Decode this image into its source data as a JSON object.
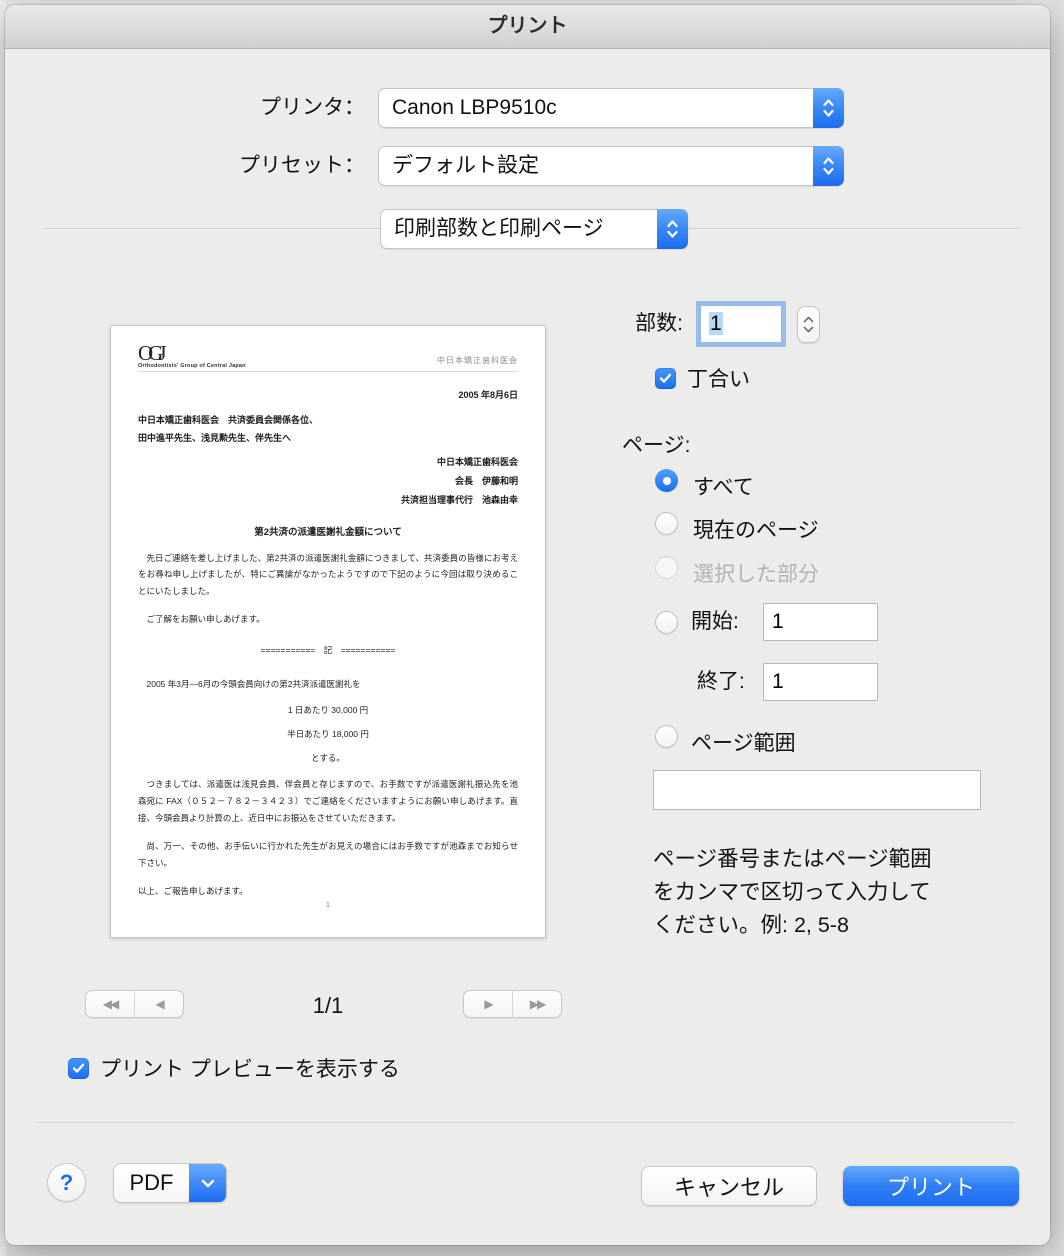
{
  "window": {
    "title": "プリント"
  },
  "form": {
    "printer_label": "プリンタ：",
    "printer_value": "Canon LBP9510c",
    "preset_label": "プリセット：",
    "preset_value": "デフォルト設定",
    "section_value": "印刷部数と印刷ページ"
  },
  "copies": {
    "label": "部数:",
    "value": "1",
    "collate_label": "丁合い",
    "collate_checked": true
  },
  "pages": {
    "label": "ページ:",
    "all_label": "すべて",
    "current_label": "現在のページ",
    "selection_label": "選択した部分",
    "from_label": "開始:",
    "from_value": "1",
    "to_label": "終了:",
    "to_value": "1",
    "range_label": "ページ範囲",
    "range_value": "",
    "hint_line1": "ページ番号またはページ範囲",
    "hint_line2": "をカンマで区切って入力して",
    "hint_line3": "ください。例: 2, 5-8"
  },
  "preview": {
    "page_indicator": "1/1",
    "show_preview_label": "プリント プレビューを表示する",
    "show_preview_checked": true,
    "nav": {
      "first": "◀◀",
      "prev": "◀",
      "next": "▶",
      "last": "▶▶"
    },
    "document": {
      "logo_monogram": "OGJ",
      "logo_tagline": "Orthodontists' Group of Central Japan",
      "header_org": "中日本矯正歯科医会",
      "date": "2005 年8月6日",
      "recipient_line1": "中日本矯正歯科医会　共済委員会関係各位、",
      "recipient_line2": "田中進平先生、浅見勲先生、伴先生へ",
      "sender_line1": "中日本矯正歯科医会",
      "sender_line2": "会長　伊藤和明",
      "sender_line3": "共済担当理事代行　池森由幸",
      "subject": "第2共済の派遣医謝礼金額について",
      "body1": "先日ご連絡を差し上げました、第2共済の派遣医謝礼金額につきまして、共済委員の皆様にお考えをお尋ね申し上げましたが、特にご異論がなかったようですので下記のように今回は取り決めることにいたしました。",
      "body2": "ご了解をお願い申しあげます。",
      "record_mark": "===========　記　===========",
      "body3": "2005 年3月―6月の今頭会員向けの第2共済派遣医謝礼を",
      "amount1": "1 日あたり 30,000 円",
      "amount2": "半日あたり 18,000 円",
      "amount3": "とする。",
      "body4": "つきましては、派遣医は浅見会員、伴会員と存じますので、お手数ですが派遣医謝礼振込先を池森宛に FAX（０５２－７８２－３４２３）でご連絡をくださいますようにお願い申しあげます。直接、今頭会員より計算の上、近日中にお振込をさせていただきます。",
      "body5": "尚、万一、その他、お手伝いに行かれた先生がお見えの場合にはお手数ですが池森までお知らせ下さい。",
      "body6": "以上、ご報告申しあげます。",
      "page_number": "1"
    }
  },
  "footer": {
    "help_label": "?",
    "pdf_label": "PDF",
    "cancel_label": "キャンセル",
    "print_label": "プリント"
  },
  "colors": {
    "accent_blue": "#1c6cf1",
    "focus_ring": "#7dabee",
    "dialog_bg": "#ececea"
  }
}
